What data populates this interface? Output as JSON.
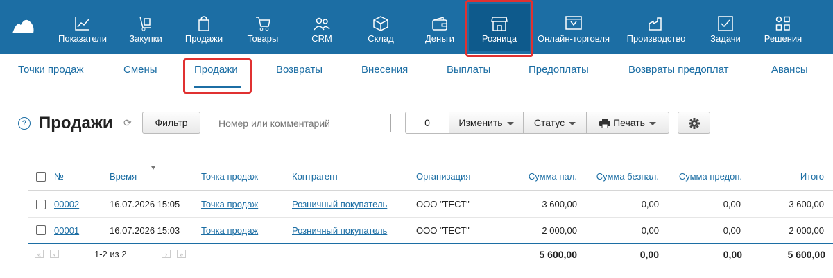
{
  "nav": {
    "items": [
      {
        "label": "Показатели",
        "icon": "chart-line-icon"
      },
      {
        "label": "Закупки",
        "icon": "cart-dolly-icon"
      },
      {
        "label": "Продажи",
        "icon": "shopping-bag-icon"
      },
      {
        "label": "Товары",
        "icon": "shopping-cart-icon"
      },
      {
        "label": "CRM",
        "icon": "users-icon"
      },
      {
        "label": "Склад",
        "icon": "box-icon"
      },
      {
        "label": "Деньги",
        "icon": "wallet-icon"
      },
      {
        "label": "Розница",
        "icon": "storefront-icon",
        "active": true
      },
      {
        "label": "Онлайн-торговля",
        "icon": "online-store-icon"
      },
      {
        "label": "Производство",
        "icon": "factory-icon"
      },
      {
        "label": "Задачи",
        "icon": "checkbox-icon"
      },
      {
        "label": "Решения",
        "icon": "apps-icon"
      }
    ]
  },
  "subnav": {
    "items": [
      {
        "label": "Точки продаж"
      },
      {
        "label": "Смены"
      },
      {
        "label": "Продажи",
        "active": true
      },
      {
        "label": "Возвраты"
      },
      {
        "label": "Внесения"
      },
      {
        "label": "Выплаты"
      },
      {
        "label": "Предоплаты"
      },
      {
        "label": "Возвраты предоплат"
      },
      {
        "label": "Авансы"
      }
    ]
  },
  "toolbar": {
    "title": "Продажи",
    "filter_label": "Фильтр",
    "search_placeholder": "Номер или комментарий",
    "selected_count": "0",
    "change_label": "Изменить",
    "status_label": "Статус",
    "print_label": "Печать"
  },
  "table": {
    "headers": [
      "№",
      "Время",
      "Точка продаж",
      "Контрагент",
      "Организация",
      "Сумма нал.",
      "Сумма безнал.",
      "Сумма предоп.",
      "Итого"
    ],
    "rows": [
      {
        "num": "00002",
        "time": "16.07.2026 15:05",
        "point": "Точка продаж",
        "counterparty": "Розничный покупатель",
        "org": "ООО \"ТЕСТ\"",
        "cash": "3 600,00",
        "cashless": "0,00",
        "prepaid": "0,00",
        "total": "3 600,00"
      },
      {
        "num": "00001",
        "time": "16.07.2026 15:03",
        "point": "Точка продаж",
        "counterparty": "Розничный покупатель",
        "org": "ООО \"ТЕСТ\"",
        "cash": "2 000,00",
        "cashless": "0,00",
        "prepaid": "0,00",
        "total": "2 000,00"
      }
    ],
    "totals": {
      "cash": "5 600,00",
      "cashless": "0,00",
      "prepaid": "0,00",
      "total": "5 600,00"
    },
    "pagination": "1-2 из 2"
  },
  "colors": {
    "brand": "#1c6ea4",
    "active_nav": "#0e5a8c",
    "highlight": "#e03131"
  }
}
